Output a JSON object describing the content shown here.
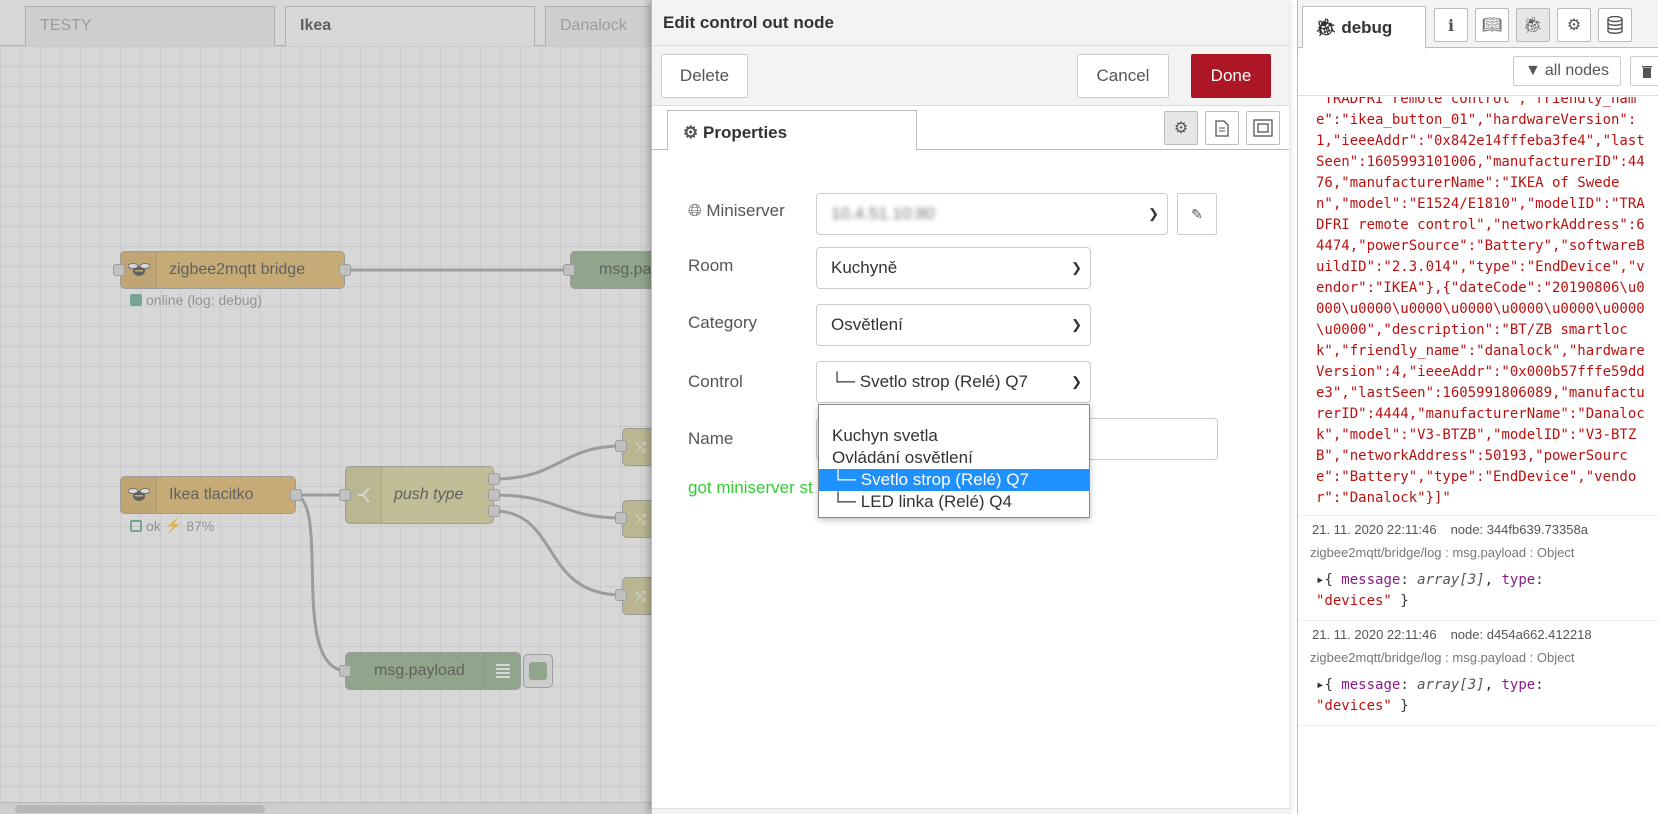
{
  "workspace": {
    "tabs": [
      {
        "label": "TESTY"
      },
      {
        "label": "Ikea"
      },
      {
        "label": "Danalock"
      }
    ],
    "nodes": {
      "bridge": {
        "label": "zigbee2mqtt bridge",
        "status": "online (log: debug)"
      },
      "msg_top": {
        "label": "msg.pa"
      },
      "ikea": {
        "label": "Ikea tlacitko",
        "status_ok": "ok",
        "status_battery": "87%"
      },
      "push": {
        "label": "push type"
      },
      "payload": {
        "label": "msg.payload"
      }
    }
  },
  "tray": {
    "title": "Edit control out node",
    "delete_label": "Delete",
    "cancel_label": "Cancel",
    "done_label": "Done",
    "tab_properties": "Properties",
    "form": {
      "miniserver_label": "Miniserver",
      "miniserver_value": "10.4.51.10:80",
      "room_label": "Room",
      "room_value": "Kuchyně",
      "category_label": "Category",
      "category_value": "Osvětlení",
      "control_label": "Control",
      "control_value": "└─ Svetlo strop (Relé) Q7",
      "name_label": "Name",
      "status": "got miniserver st"
    },
    "dropdown": {
      "options": [
        "Kuchyn svetla",
        "Ovládání osvětlení",
        "└─ Svetlo strop (Relé) Q7",
        "└─ LED linka (Relé) Q4"
      ],
      "selected_index": 2
    }
  },
  "sidebar": {
    "tab_label": "debug",
    "filter_label": "all nodes",
    "messages": [
      {
        "body": "\"TRADFRI remote control\",\"friendly_name\":\"ikea_button_01\",\"hardwareVersion\":1,\"ieeeAddr\":\"0x842e14fffeba3fe4\",\"lastSeen\":1605993101006,\"manufacturerID\":4476,\"manufacturerName\":\"IKEA of Sweden\",\"model\":\"E1524/E1810\",\"modelID\":\"TRADFRI remote control\",\"networkAddress\":64474,\"powerSource\":\"Battery\",\"softwareBuildID\":\"2.3.014\",\"type\":\"EndDevice\",\"vendor\":\"IKEA\"},{\"dateCode\":\"20190806\\u0000\\u0000\\u0000\\u0000\\u0000\\u0000\\u0000\\u0000\",\"description\":\"BT/ZB smartlock\",\"friendly_name\":\"danalock\",\"hardwareVersion\":4,\"ieeeAddr\":\"0x000b57fffe59dde3\",\"lastSeen\":1605991806089,\"manufacturerID\":4444,\"manufacturerName\":\"Danalock\",\"model\":\"V3-BTZB\",\"modelID\":\"V3-BTZB\",\"networkAddress\":50193,\"powerSource\":\"Battery\",\"type\":\"EndDevice\",\"vendor\":\"Danalock\"}]\""
      },
      {
        "time": "21. 11. 2020 22:11:46",
        "node": "node: 344fb639.73358a",
        "topic": "zigbee2mqtt/bridge/log : msg.payload : Object",
        "obj_message_key": "message",
        "obj_message_val": "array[3]",
        "obj_type_key": "type",
        "obj_type_val": "\"devices\""
      },
      {
        "time": "21. 11. 2020 22:11:46",
        "node": "node: d454a662.412218",
        "topic": "zigbee2mqtt/bridge/log : msg.payload : Object",
        "obj_message_key": "message",
        "obj_message_val": "array[3]",
        "obj_type_key": "type",
        "obj_type_val": "\"devices\""
      }
    ]
  },
  "colors": {
    "done": "#ad1625",
    "node_mqtt": "#e2b45a",
    "node_switch": "#d9d28f",
    "node_debug": "#87a980",
    "status_text": "#33cc33",
    "selection": "#1e90ff"
  }
}
